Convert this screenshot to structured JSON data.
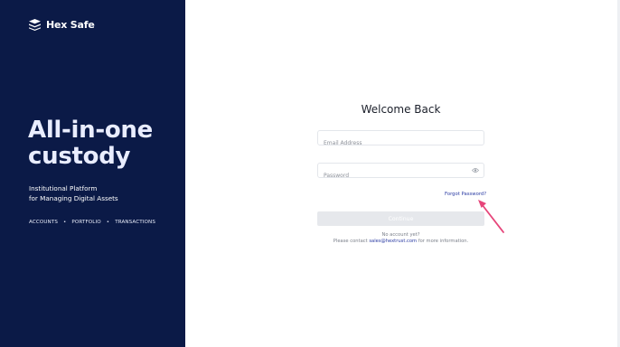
{
  "brand": {
    "name": "Hex Safe",
    "icon": "hexsafe-logo-icon"
  },
  "hero": {
    "title_line1": "All-in-one",
    "title_line2": "custody",
    "subtitle_line1": "Institutional Platform",
    "subtitle_line2": "for Managing Digital Assets",
    "links": [
      "ACCOUNTS",
      "PORTFOLIO",
      "TRANSACTIONS"
    ],
    "separator": "•"
  },
  "login": {
    "heading": "Welcome Back",
    "email_placeholder": "Email Address",
    "email_value": "",
    "password_placeholder": "Password",
    "password_value": "",
    "forgot_label": "Forgot Password?",
    "continue_label": "Continue",
    "no_account": "No account yet?",
    "contact_prefix": "Please contact ",
    "contact_email": "sales@hextrust.com",
    "contact_suffix": " for more information."
  },
  "colors": {
    "panel_bg": "#0b1a47",
    "link_blue": "#2a3ba3",
    "annotation_arrow": "#e6457a",
    "button_disabled": "#e6e8ec"
  }
}
